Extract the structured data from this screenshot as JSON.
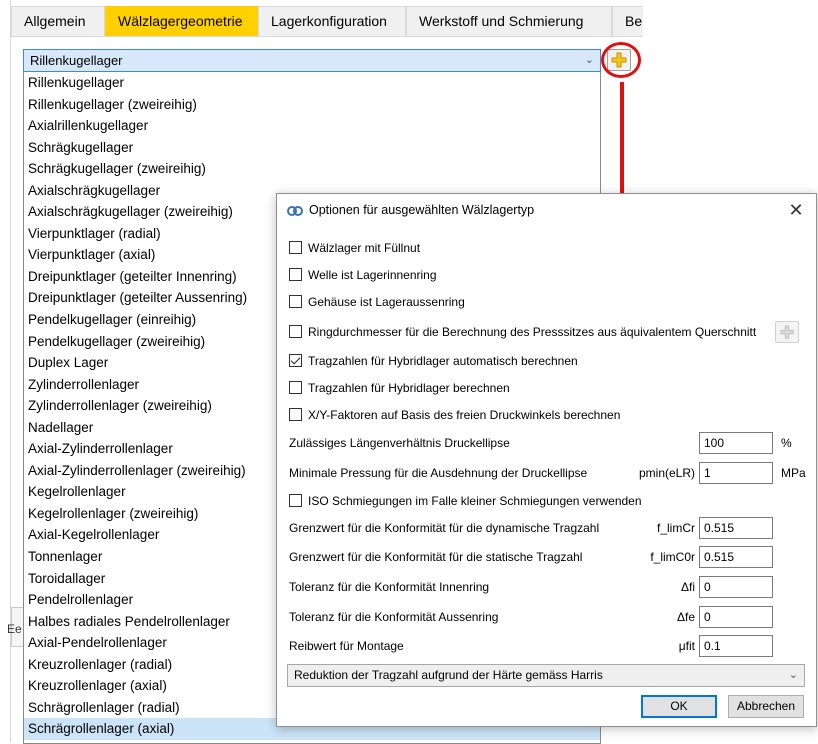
{
  "tabs": [
    "Allgemein",
    "Wälzlagergeometrie",
    "Lagerkonfiguration",
    "Werkstoff und Schmierung",
    "Bela"
  ],
  "active_tab": "Wälzlagergeometrie",
  "bearing_combo": {
    "value": "Rillenkugellager"
  },
  "bearing_list": [
    "Rillenkugellager",
    "Rillenkugellager (zweireihig)",
    "Axialrillenkugellager",
    "Schrägkugellager",
    "Schrägkugellager (zweireihig)",
    "Axialschrägkugellager",
    "Axialschrägkugellager (zweireihig)",
    "Vierpunktlager (radial)",
    "Vierpunktlager (axial)",
    "Dreipunktlager (geteilter Innenring)",
    "Dreipunktlager (geteilter Aussenring)",
    "Pendelkugellager (einreihig)",
    "Pendelkugellager (zweireihig)",
    "Duplex Lager",
    "Zylinderrollenlager",
    "Zylinderrollenlager (zweireihig)",
    "Nadellager",
    "Axial-Zylinderrollenlager",
    "Axial-Zylinderrollenlager (zweireihig)",
    "Kegelrollenlager",
    "Kegelrollenlager (zweireihig)",
    "Axial-Kegelrollenlager",
    "Tonnenlager",
    "Toroidallager",
    "Pendelrollenlager",
    "Halbes radiales Pendelrollenlager",
    "Axial-Pendelrollenlager",
    "Kreuzrollenlager (radial)",
    "Kreuzrollenlager (axial)",
    "Schrägrollenlager (radial)",
    "Schrägrollenlager (axial)"
  ],
  "selected_list_item": "Schrägrollenlager (axial)",
  "side_fragment": "Ee",
  "dialog": {
    "title": "Optionen für ausgewählten Wälzlagertyp",
    "checkboxes": [
      {
        "label": "Wälzlager mit Füllnut",
        "checked": false
      },
      {
        "label": "Welle ist Lagerinnenring",
        "checked": false
      },
      {
        "label": "Gehäuse ist Lageraussenring",
        "checked": false
      },
      {
        "label": "Ringdurchmesser für die Berechnung des Presssitzes aus äquivalentem Querschnitt",
        "checked": false
      },
      {
        "label": "Tragzahlen für Hybridlager automatisch berechnen",
        "checked": true
      },
      {
        "label": "Tragzahlen für Hybridlager berechnen",
        "checked": false
      },
      {
        "label": "X/Y-Faktoren auf Basis des freien Druckwinkels berechnen",
        "checked": false
      }
    ],
    "length_ratio": {
      "label": "Zulässiges Längenverhältnis Druckellipse",
      "value": "100",
      "unit": "%"
    },
    "min_pressure": {
      "label": "Minimale Pressung für die Ausdehnung der Druckellipse",
      "symbol": "pmin(eLR)",
      "value": "1",
      "unit": "MPa"
    },
    "iso_checkbox": {
      "label": "ISO Schmiegungen im Falle kleiner Schmiegungen verwenden",
      "checked": false
    },
    "params": [
      {
        "label": "Grenzwert für die Konformität für die dynamische Tragzahl",
        "symbol": "f_limCr",
        "value": "0.515"
      },
      {
        "label": "Grenzwert für die Konformität für die statische Tragzahl",
        "symbol": "f_limC0r",
        "value": "0.515"
      },
      {
        "label": "Toleranz für die Konformität Innenring",
        "symbol": "Δfi",
        "value": "0"
      },
      {
        "label": "Toleranz für die Konformität Aussenring",
        "symbol": "Δfe",
        "value": "0"
      },
      {
        "label": "Reibwert für Montage",
        "symbol": "μfit",
        "value": "0.1"
      }
    ],
    "harris_select": {
      "value": "Reduktion der Tragzahl aufgrund der Härte gemäss Harris"
    },
    "ok_label": "OK",
    "cancel_label": "Abbrechen"
  },
  "colors": {
    "active_tab": "#ffd000",
    "annotation": "#e01010",
    "selection": "#cce4f7",
    "plus_icon": "#f5c518"
  }
}
